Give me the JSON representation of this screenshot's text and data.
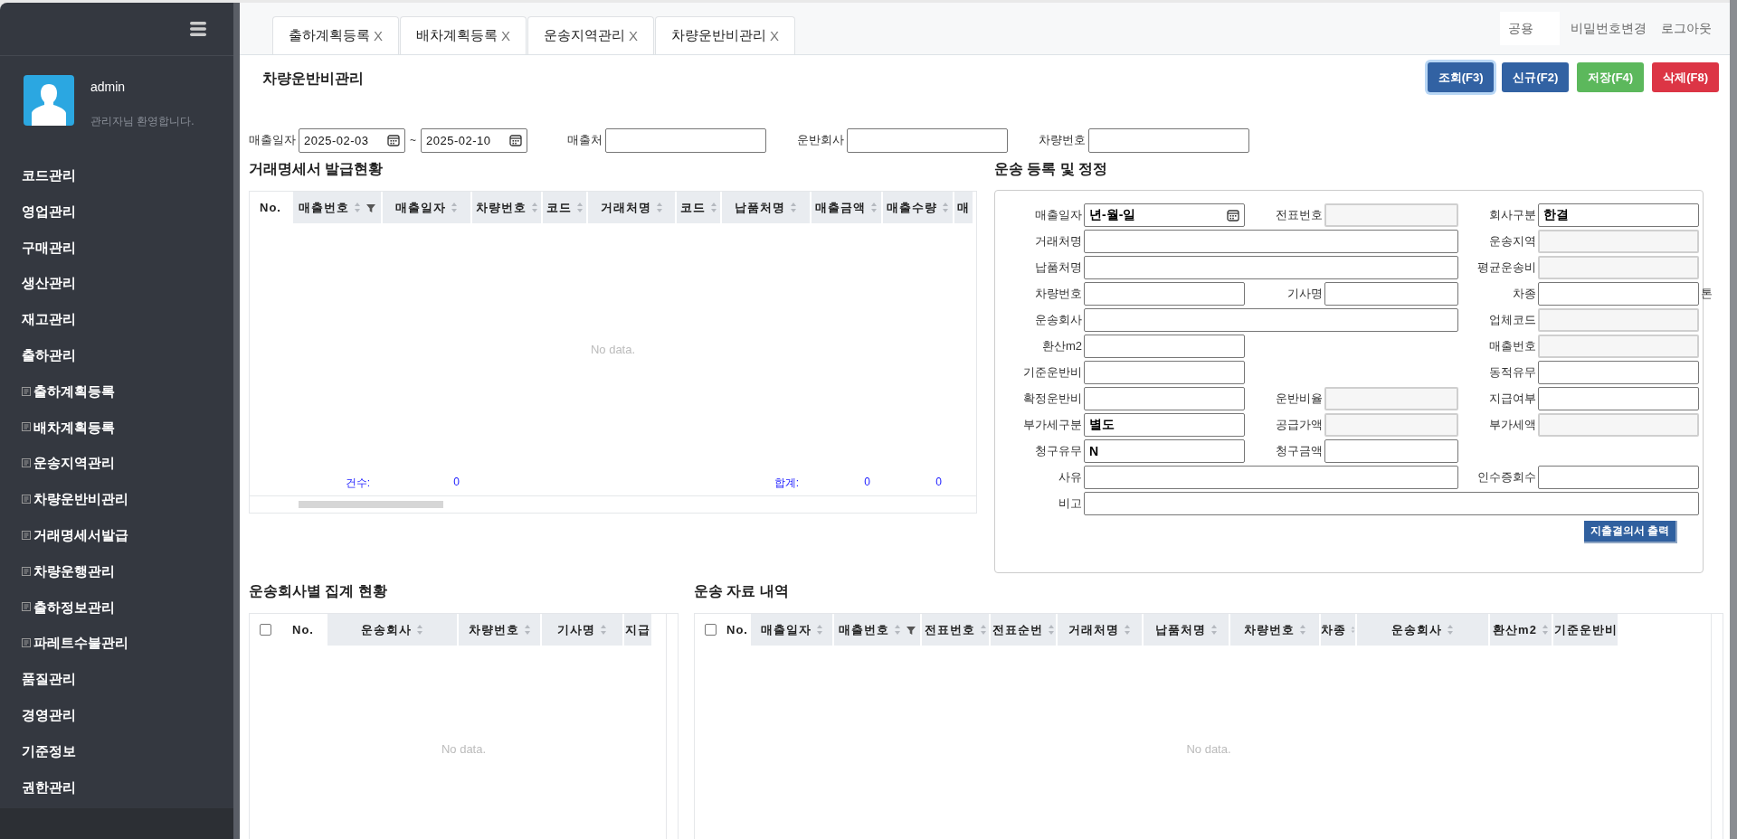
{
  "sidebar": {
    "user": {
      "name": "admin",
      "greeting": "관리자님 환영합니다."
    },
    "menu": [
      {
        "label": "코드관리"
      },
      {
        "label": "영업관리"
      },
      {
        "label": "구매관리"
      },
      {
        "label": "생산관리"
      },
      {
        "label": "재고관리"
      },
      {
        "label": "출하관리",
        "children": [
          {
            "label": "출하계획등록"
          },
          {
            "label": "배차계획등록"
          },
          {
            "label": "운송지역관리"
          },
          {
            "label": "차량운반비관리"
          },
          {
            "label": "거래명세서발급"
          },
          {
            "label": "차량운행관리"
          },
          {
            "label": "출하정보관리"
          },
          {
            "label": "파레트수불관리"
          }
        ]
      },
      {
        "label": "품질관리"
      },
      {
        "label": "경영관리"
      },
      {
        "label": "기준정보"
      },
      {
        "label": "권한관리"
      }
    ]
  },
  "tabs": [
    {
      "label": "출하계획등록",
      "close": "X"
    },
    {
      "label": "배차계획등록",
      "close": "X"
    },
    {
      "label": "운송지역관리",
      "close": "X"
    },
    {
      "label": "차량운반비관리",
      "close": "X"
    }
  ],
  "header": {
    "scope": "공용",
    "links": [
      "비밀번호변경",
      "로그아웃"
    ]
  },
  "page_title": "차량운반비관리",
  "buttons": [
    {
      "label": "조회(F3)",
      "kind": "primary",
      "focused": true
    },
    {
      "label": "신규(F2)",
      "kind": "primary",
      "focused": false
    },
    {
      "label": "저장(F4)",
      "kind": "success",
      "focused": false
    },
    {
      "label": "삭제(F8)",
      "kind": "danger",
      "focused": false
    }
  ],
  "search": [
    {
      "label": "매출일자",
      "kind": "date_range",
      "from": "2025-02-03",
      "separator": "~",
      "to": "2025-02-10"
    },
    {
      "label": "매출처",
      "kind": "text"
    },
    {
      "label": "운반회사",
      "kind": "text"
    },
    {
      "label": "차량번호",
      "kind": "text"
    }
  ],
  "invoice_grid": {
    "title": "거래명세서 발급현황",
    "empty_text": "No data.",
    "checkbox": false,
    "columns": [
      {
        "label": "No.",
        "sortable": false,
        "filter": false
      },
      {
        "label": "매출번호",
        "sortable": true,
        "filter": true,
        "footer": "건수:"
      },
      {
        "label": "매출일자",
        "sortable": true,
        "filter": false,
        "footer": "0"
      },
      {
        "label": "차량번호",
        "sortable": true,
        "filter": false
      },
      {
        "label": "코드",
        "sortable": true,
        "filter": false
      },
      {
        "label": "거래처명",
        "sortable": true,
        "filter": false
      },
      {
        "label": "코드",
        "sortable": true,
        "filter": false
      },
      {
        "label": "납품처명",
        "sortable": true,
        "filter": false,
        "footer": "합계:"
      },
      {
        "label": "매출금액",
        "sortable": true,
        "filter": false,
        "footer": "0"
      },
      {
        "label": "매출수량",
        "sortable": true,
        "filter": false,
        "footer": "0"
      },
      {
        "label": "매",
        "sortable": false,
        "filter": false
      }
    ]
  },
  "transport_form": {
    "title": "운송 등록 및 정정",
    "print_button": "지출결의서 출력",
    "rows": [
      [
        {
          "label": "매출일자",
          "kind": "date",
          "value": "년-월-일"
        },
        {
          "label": "전표번호",
          "kind": "readonly"
        },
        {
          "label": "회사구분",
          "kind": "text",
          "value": "한결"
        }
      ],
      [
        {
          "label": "거래처명",
          "kind": "text",
          "wide": true
        },
        null,
        {
          "label": "운송지역",
          "kind": "readonly"
        }
      ],
      [
        {
          "label": "납품처명",
          "kind": "text",
          "wide": true
        },
        null,
        {
          "label": "평균운송비",
          "kind": "readonly"
        }
      ],
      [
        {
          "label": "차량번호",
          "kind": "text"
        },
        {
          "label": "기사명",
          "kind": "text"
        },
        {
          "label": "차종",
          "kind": "text",
          "unit": "톤"
        }
      ],
      [
        {
          "label": "운송회사",
          "kind": "text",
          "wide": true
        },
        null,
        {
          "label": "업체코드",
          "kind": "readonly"
        }
      ],
      [
        {
          "label": "환산m2",
          "kind": "text",
          "wide": false
        },
        null,
        {
          "label": "매출번호",
          "kind": "readonly"
        }
      ],
      [
        {
          "label": "기준운반비",
          "kind": "text",
          "wide": false
        },
        null,
        {
          "label": "동적유무",
          "kind": "text"
        }
      ],
      [
        {
          "label": "확정운반비",
          "kind": "text"
        },
        {
          "label": "운반비율",
          "kind": "readonly"
        },
        {
          "label": "지급여부",
          "kind": "text"
        }
      ],
      [
        {
          "label": "부가세구분",
          "kind": "text",
          "value": "별도"
        },
        {
          "label": "공급가액",
          "kind": "readonly"
        },
        {
          "label": "부가세액",
          "kind": "readonly"
        }
      ],
      [
        {
          "label": "청구유무",
          "kind": "text",
          "value": "N"
        },
        {
          "label": "청구금액",
          "kind": "text",
          "wide": false
        },
        null
      ],
      [
        {
          "label": "사유",
          "kind": "text",
          "wide": true
        },
        null,
        {
          "label": "인수증회수",
          "kind": "text"
        }
      ],
      [
        {
          "label": "비고",
          "kind": "text",
          "wide": true
        },
        null,
        null
      ]
    ]
  },
  "company_grid": {
    "title": "운송회사별 집계 현황",
    "empty_text": "No data.",
    "checkbox": true,
    "all_checked": false,
    "columns": [
      {
        "label": "No.",
        "sortable": false,
        "filter": false
      },
      {
        "label": "운송회사",
        "sortable": true,
        "filter": false
      },
      {
        "label": "차량번호",
        "sortable": true,
        "filter": false
      },
      {
        "label": "기사명",
        "sortable": true,
        "filter": false
      },
      {
        "label": "지급",
        "sortable": false,
        "filter": false
      }
    ]
  },
  "transport_grid": {
    "title": "운송 자료 내역",
    "empty_text": "No data.",
    "checkbox": true,
    "all_checked": false,
    "columns": [
      {
        "label": "No.",
        "sortable": false,
        "filter": false
      },
      {
        "label": "매출일자",
        "sortable": true,
        "filter": false
      },
      {
        "label": "매출번호",
        "sortable": true,
        "filter": true
      },
      {
        "label": "전표번호",
        "sortable": true,
        "filter": false
      },
      {
        "label": "전표순번",
        "sortable": true,
        "filter": false
      },
      {
        "label": "거래처명",
        "sortable": true,
        "filter": false
      },
      {
        "label": "납품처명",
        "sortable": true,
        "filter": false
      },
      {
        "label": "차량번호",
        "sortable": true,
        "filter": false
      },
      {
        "label": "차종",
        "sortable": true,
        "filter": false
      },
      {
        "label": "운송회사",
        "sortable": true,
        "filter": false
      },
      {
        "label": "환산m2",
        "sortable": true,
        "filter": false
      },
      {
        "label": "기준운반비",
        "sortable": false,
        "filter": false
      }
    ]
  }
}
